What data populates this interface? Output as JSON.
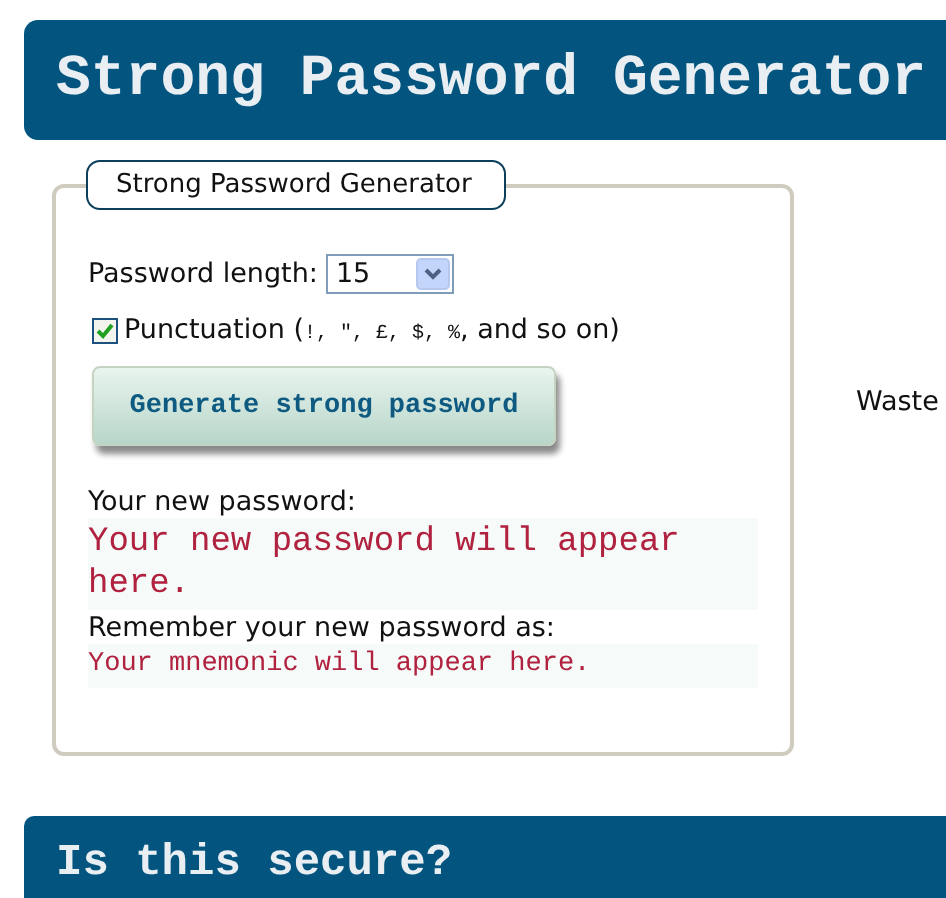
{
  "header": {
    "title": "Strong Password Generator"
  },
  "generator": {
    "legend": "Strong Password Generator",
    "length": {
      "label": "Password length:",
      "value": "15"
    },
    "punctuation": {
      "checked": true,
      "label": "Punctuation (",
      "symbols": "!, \", £, $, %",
      "suffix": ", and so on)"
    },
    "generate_button": "Generate strong password",
    "password": {
      "label": "Your new password:",
      "value": "Your new password will appear here."
    },
    "mnemonic": {
      "label": "Remember your new password as:",
      "value": "Your mnemonic will appear here."
    }
  },
  "side_text": "Waste",
  "section": {
    "title": "Is this secure?"
  }
}
